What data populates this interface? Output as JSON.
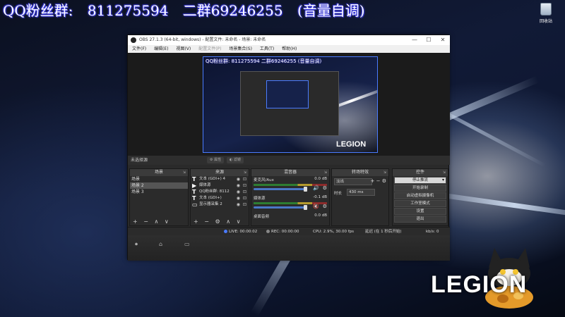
{
  "overlay": {
    "qq_label": "QQ粉丝群:",
    "qq_number": "811275594",
    "group2": "二群69246255",
    "note": "(音量自调)"
  },
  "desktop": {
    "recycle_bin_label": "回收站",
    "logo_text": "LEGION"
  },
  "obs": {
    "window_title": "OBS 27.1.3 (64-bit, windows) - 配置文件: 未命名 - 场景: 未命名",
    "window_controls": [
      "—",
      "☐",
      "✕"
    ],
    "menu": [
      "文件(F)",
      "编辑(E)",
      "视图(V)",
      "配置文件(P)",
      "场景集合(S)",
      "工具(T)",
      "帮助(H)"
    ],
    "menu_disabled_index": 3,
    "preview": {
      "overlay_text": "QQ粉丝群: 811275594  二群69246255  (音量自调)",
      "logo": "LEGION"
    },
    "source_toolbar": {
      "selected": "未选择源",
      "properties_button": "属性",
      "filters_button": "滤镜"
    },
    "docks": {
      "scenes": {
        "title": "场景",
        "items": [
          {
            "label": "场景",
            "active": false
          },
          {
            "label": "场景 2",
            "active": true
          },
          {
            "label": "场景 3",
            "active": false
          }
        ],
        "footer": "+ − ∧ ∨"
      },
      "sources": {
        "title": "来源",
        "items": [
          {
            "label": "文本 (GDI+) 4"
          },
          {
            "label": "媒体源"
          },
          {
            "label": "QQ粉丝群: 8112"
          },
          {
            "label": "文本 (GDI+)"
          },
          {
            "label": "显示器采集 2"
          }
        ],
        "footer": "+ − ⚙ ∧ ∨"
      },
      "mixer": {
        "title": "混音器",
        "channels": [
          {
            "name": "麦克风/Aux",
            "db": "0.0 dB",
            "muted": false
          },
          {
            "name": "媒体源",
            "db": "-0.1 dB",
            "muted": true
          },
          {
            "name": "桌面音频",
            "db": "0.0 dB",
            "muted": false
          }
        ]
      },
      "transitions": {
        "title": "转场特效",
        "type": "淡出",
        "duration_label": "时长",
        "duration_value": "430 ms"
      },
      "controls": {
        "title": "控件",
        "buttons": [
          {
            "label": "停止推流",
            "dropdown": true
          },
          {
            "label": "开始录制",
            "dropdown": false
          },
          {
            "label": "启动虚拟摄像机",
            "dropdown": false
          },
          {
            "label": "工作室模式",
            "dropdown": false
          },
          {
            "label": "设置",
            "dropdown": false
          },
          {
            "label": "退出",
            "dropdown": false
          }
        ]
      }
    },
    "status": {
      "live": "LIVE: 00:00:02",
      "rec": "REC: 00:00:00",
      "cpu": "CPU: 2.9%, 30.00 fps",
      "dropped": "延迟 (在 1 秒后开始)",
      "bitrate": "kb/s: 0"
    }
  },
  "colors": {
    "accent_blue": "#4a7bff",
    "mute_red": "#e33333",
    "obs_bg": "#2a2a2a"
  }
}
